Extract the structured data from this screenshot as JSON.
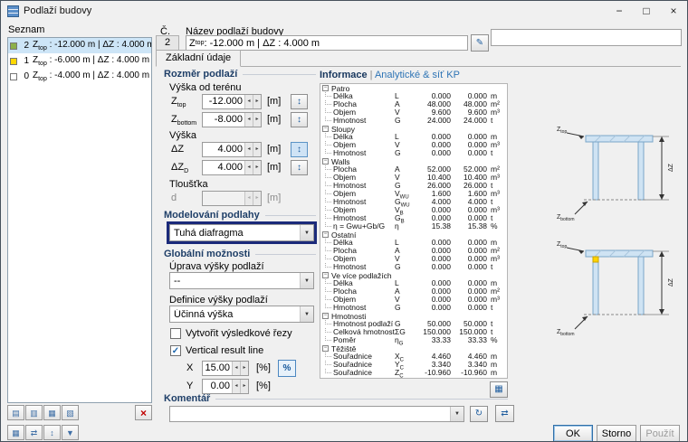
{
  "window": {
    "title": "Podlaží budovy"
  },
  "icons": {
    "minimize": "−",
    "maximize": "□",
    "close": "×",
    "edit": "✎",
    "pick": "↕",
    "dropdown": "▼",
    "check": "✓",
    "percent": "%",
    "delete": "×",
    "refresh": "↻",
    "exchange": "⇄",
    "grid": "▦",
    "collapse": "−",
    "spin_left": "◂",
    "spin_right": "▸",
    "tb1": "▤",
    "tb2": "▥",
    "tb3": "▦",
    "tb4": "▧",
    "tb5": "▦",
    "tb6": "⇄",
    "tb7": "↕",
    "tb8": "▼"
  },
  "list": {
    "label": "Seznam",
    "items": [
      {
        "num": "2",
        "marker": "#8db04a",
        "sym": "Z",
        "sub": "top",
        "rest": " : -12.000 m | ΔZ : 4.000 m",
        "selected": true
      },
      {
        "num": "1",
        "marker": "#ffd800",
        "sym": "Z",
        "sub": "top",
        "rest": " : -6.000 m | ΔZ : 4.000 m",
        "selected": false
      },
      {
        "num": "0",
        "marker": "#ffffff",
        "sym": "Z",
        "sub": "top",
        "rest": " : -4.000 m | ΔZ : 4.000 m",
        "selected": false
      }
    ]
  },
  "header": {
    "no_label": "Č.",
    "no_value": "2",
    "name_label": "Název podlaží budovy",
    "name_sym": "Z",
    "name_sub": "top",
    "name_rest": " : -12.000 m | ΔZ : 4.000 m"
  },
  "tabs": {
    "basic": "Základní údaje"
  },
  "form": {
    "section_dimensions": "Rozměr podlaží",
    "group_terrain": "Výška od terénu",
    "ztop": {
      "sym": "Z",
      "sub": "top",
      "value": "-12.000",
      "unit": "[m]"
    },
    "zbottom": {
      "sym": "Z",
      "sub": "bottom",
      "value": "-8.000",
      "unit": "[m]"
    },
    "group_height": "Výška",
    "dz": {
      "sym": "ΔZ",
      "sub": "",
      "value": "4.000",
      "unit": "[m]"
    },
    "dzd": {
      "sym": "ΔZ",
      "sub": "D",
      "value": "4.000",
      "unit": "[m]"
    },
    "group_thickness": "Tloušťka",
    "d": {
      "sym": "d",
      "sub": "",
      "value": "",
      "unit": "[m]"
    },
    "section_floor": "Modelování podlahy",
    "floor_model": "Tuhá diafragma",
    "section_global": "Globální možnosti",
    "label_adjust": "Úprava výšky podlaží",
    "adjust_value": "--",
    "label_definition": "Definice výšky podlaží",
    "definition_value": "Účinná výška",
    "check_sections": "Vytvořit výsledkové řezy",
    "check_vline": "Vertical result line",
    "x": {
      "label": "X",
      "value": "15.00",
      "unit": "[%]"
    },
    "y": {
      "label": "Y",
      "value": "0.00",
      "unit": "[%]"
    }
  },
  "info": {
    "title_left": "Informace",
    "title_sep": " | ",
    "title_right": "Analytické & síť KP",
    "groups": [
      {
        "name": "Patro",
        "rows": [
          {
            "label": "Délka",
            "s": "L",
            "ss": "",
            "v1": "0.000",
            "v2": "0.000",
            "u": "m"
          },
          {
            "label": "Plocha",
            "s": "A",
            "ss": "",
            "v1": "48.000",
            "v2": "48.000",
            "u": "m²"
          },
          {
            "label": "Objem",
            "s": "V",
            "ss": "",
            "v1": "9.600",
            "v2": "9.600",
            "u": "m³"
          },
          {
            "label": "Hmotnost",
            "s": "G",
            "ss": "",
            "v1": "24.000",
            "v2": "24.000",
            "u": "t"
          }
        ]
      },
      {
        "name": "Sloupy",
        "rows": [
          {
            "label": "Délka",
            "s": "L",
            "ss": "",
            "v1": "0.000",
            "v2": "0.000",
            "u": "m"
          },
          {
            "label": "Objem",
            "s": "V",
            "ss": "",
            "v1": "0.000",
            "v2": "0.000",
            "u": "m³"
          },
          {
            "label": "Hmotnost",
            "s": "G",
            "ss": "",
            "v1": "0.000",
            "v2": "0.000",
            "u": "t"
          }
        ]
      },
      {
        "name": "Walls",
        "rows": [
          {
            "label": "Plocha",
            "s": "A",
            "ss": "",
            "v1": "52.000",
            "v2": "52.000",
            "u": "m²"
          },
          {
            "label": "Objem",
            "s": "V",
            "ss": "",
            "v1": "10.400",
            "v2": "10.400",
            "u": "m³"
          },
          {
            "label": "Hmotnost",
            "s": "G",
            "ss": "",
            "v1": "26.000",
            "v2": "26.000",
            "u": "t"
          },
          {
            "label": "Objem",
            "s": "V",
            "ss": "WU",
            "v1": "1.600",
            "v2": "1.600",
            "u": "m³"
          },
          {
            "label": "Hmotnost",
            "s": "G",
            "ss": "WU",
            "v1": "4.000",
            "v2": "4.000",
            "u": "t"
          },
          {
            "label": "Objem",
            "s": "V",
            "ss": "B",
            "v1": "0.000",
            "v2": "0.000",
            "u": "m³"
          },
          {
            "label": "Hmotnost",
            "s": "G",
            "ss": "B",
            "v1": "0.000",
            "v2": "0.000",
            "u": "t"
          },
          {
            "label": "η = Gwu+Gb/G",
            "s": "η",
            "ss": "",
            "v1": "15.38",
            "v2": "15.38",
            "u": "%"
          }
        ]
      },
      {
        "name": "Ostatní",
        "rows": [
          {
            "label": "Délka",
            "s": "L",
            "ss": "",
            "v1": "0.000",
            "v2": "0.000",
            "u": "m"
          },
          {
            "label": "Plocha",
            "s": "A",
            "ss": "",
            "v1": "0.000",
            "v2": "0.000",
            "u": "m²"
          },
          {
            "label": "Objem",
            "s": "V",
            "ss": "",
            "v1": "0.000",
            "v2": "0.000",
            "u": "m³"
          },
          {
            "label": "Hmotnost",
            "s": "G",
            "ss": "",
            "v1": "0.000",
            "v2": "0.000",
            "u": "t"
          }
        ]
      },
      {
        "name": "Ve více podlažích",
        "rows": [
          {
            "label": "Délka",
            "s": "L",
            "ss": "",
            "v1": "0.000",
            "v2": "0.000",
            "u": "m"
          },
          {
            "label": "Plocha",
            "s": "A",
            "ss": "",
            "v1": "0.000",
            "v2": "0.000",
            "u": "m²"
          },
          {
            "label": "Objem",
            "s": "V",
            "ss": "",
            "v1": "0.000",
            "v2": "0.000",
            "u": "m³"
          },
          {
            "label": "Hmotnost",
            "s": "G",
            "ss": "",
            "v1": "0.000",
            "v2": "0.000",
            "u": "t"
          }
        ]
      },
      {
        "name": "Hmotnosti",
        "rows": [
          {
            "label": "Hmotnost podlaží",
            "s": "G",
            "ss": "",
            "v1": "50.000",
            "v2": "50.000",
            "u": "t"
          },
          {
            "label": "Celková hmotnost",
            "s": "ΣG",
            "ss": "",
            "v1": "150.000",
            "v2": "150.000",
            "u": "t"
          },
          {
            "label": "Poměr",
            "s": "η",
            "ss": "G",
            "v1": "33.33",
            "v2": "33.33",
            "u": "%"
          }
        ]
      },
      {
        "name": "Těžiště",
        "rows": [
          {
            "label": "Souřadnice",
            "s": "X",
            "ss": "C",
            "v1": "4.460",
            "v2": "4.460",
            "u": "m"
          },
          {
            "label": "Souřadnice",
            "s": "Y",
            "ss": "C",
            "v1": "3.340",
            "v2": "3.340",
            "u": "m"
          },
          {
            "label": "Souřadnice",
            "s": "Z",
            "ss": "C",
            "v1": "-10.960",
            "v2": "-10.960",
            "u": "m"
          }
        ]
      }
    ]
  },
  "diagram": {
    "z_sym": "Z",
    "top_sub": "top",
    "bottom_sub": "bottom",
    "dim": "ΔZ"
  },
  "comment": {
    "label": "Komentář",
    "value": ""
  },
  "footer": {
    "ok": "OK",
    "cancel": "Storno",
    "apply": "Použít"
  }
}
